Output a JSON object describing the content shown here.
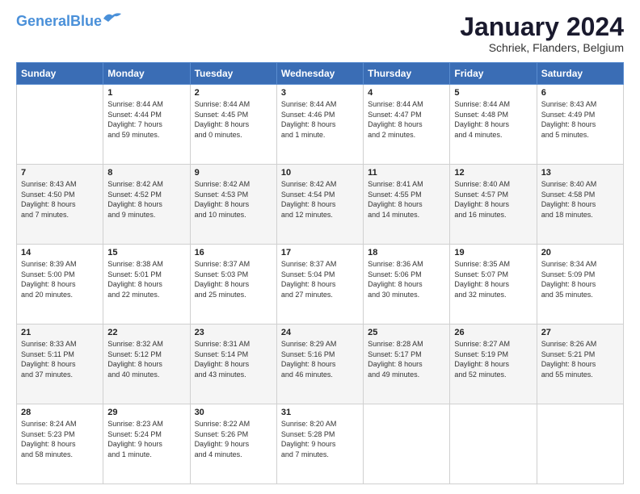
{
  "logo": {
    "part1": "General",
    "part2": "Blue"
  },
  "title": "January 2024",
  "subtitle": "Schriek, Flanders, Belgium",
  "headers": [
    "Sunday",
    "Monday",
    "Tuesday",
    "Wednesday",
    "Thursday",
    "Friday",
    "Saturday"
  ],
  "weeks": [
    [
      {
        "day": "",
        "info": ""
      },
      {
        "day": "1",
        "info": "Sunrise: 8:44 AM\nSunset: 4:44 PM\nDaylight: 7 hours\nand 59 minutes."
      },
      {
        "day": "2",
        "info": "Sunrise: 8:44 AM\nSunset: 4:45 PM\nDaylight: 8 hours\nand 0 minutes."
      },
      {
        "day": "3",
        "info": "Sunrise: 8:44 AM\nSunset: 4:46 PM\nDaylight: 8 hours\nand 1 minute."
      },
      {
        "day": "4",
        "info": "Sunrise: 8:44 AM\nSunset: 4:47 PM\nDaylight: 8 hours\nand 2 minutes."
      },
      {
        "day": "5",
        "info": "Sunrise: 8:44 AM\nSunset: 4:48 PM\nDaylight: 8 hours\nand 4 minutes."
      },
      {
        "day": "6",
        "info": "Sunrise: 8:43 AM\nSunset: 4:49 PM\nDaylight: 8 hours\nand 5 minutes."
      }
    ],
    [
      {
        "day": "7",
        "info": "Sunrise: 8:43 AM\nSunset: 4:50 PM\nDaylight: 8 hours\nand 7 minutes."
      },
      {
        "day": "8",
        "info": "Sunrise: 8:42 AM\nSunset: 4:52 PM\nDaylight: 8 hours\nand 9 minutes."
      },
      {
        "day": "9",
        "info": "Sunrise: 8:42 AM\nSunset: 4:53 PM\nDaylight: 8 hours\nand 10 minutes."
      },
      {
        "day": "10",
        "info": "Sunrise: 8:42 AM\nSunset: 4:54 PM\nDaylight: 8 hours\nand 12 minutes."
      },
      {
        "day": "11",
        "info": "Sunrise: 8:41 AM\nSunset: 4:55 PM\nDaylight: 8 hours\nand 14 minutes."
      },
      {
        "day": "12",
        "info": "Sunrise: 8:40 AM\nSunset: 4:57 PM\nDaylight: 8 hours\nand 16 minutes."
      },
      {
        "day": "13",
        "info": "Sunrise: 8:40 AM\nSunset: 4:58 PM\nDaylight: 8 hours\nand 18 minutes."
      }
    ],
    [
      {
        "day": "14",
        "info": "Sunrise: 8:39 AM\nSunset: 5:00 PM\nDaylight: 8 hours\nand 20 minutes."
      },
      {
        "day": "15",
        "info": "Sunrise: 8:38 AM\nSunset: 5:01 PM\nDaylight: 8 hours\nand 22 minutes."
      },
      {
        "day": "16",
        "info": "Sunrise: 8:37 AM\nSunset: 5:03 PM\nDaylight: 8 hours\nand 25 minutes."
      },
      {
        "day": "17",
        "info": "Sunrise: 8:37 AM\nSunset: 5:04 PM\nDaylight: 8 hours\nand 27 minutes."
      },
      {
        "day": "18",
        "info": "Sunrise: 8:36 AM\nSunset: 5:06 PM\nDaylight: 8 hours\nand 30 minutes."
      },
      {
        "day": "19",
        "info": "Sunrise: 8:35 AM\nSunset: 5:07 PM\nDaylight: 8 hours\nand 32 minutes."
      },
      {
        "day": "20",
        "info": "Sunrise: 8:34 AM\nSunset: 5:09 PM\nDaylight: 8 hours\nand 35 minutes."
      }
    ],
    [
      {
        "day": "21",
        "info": "Sunrise: 8:33 AM\nSunset: 5:11 PM\nDaylight: 8 hours\nand 37 minutes."
      },
      {
        "day": "22",
        "info": "Sunrise: 8:32 AM\nSunset: 5:12 PM\nDaylight: 8 hours\nand 40 minutes."
      },
      {
        "day": "23",
        "info": "Sunrise: 8:31 AM\nSunset: 5:14 PM\nDaylight: 8 hours\nand 43 minutes."
      },
      {
        "day": "24",
        "info": "Sunrise: 8:29 AM\nSunset: 5:16 PM\nDaylight: 8 hours\nand 46 minutes."
      },
      {
        "day": "25",
        "info": "Sunrise: 8:28 AM\nSunset: 5:17 PM\nDaylight: 8 hours\nand 49 minutes."
      },
      {
        "day": "26",
        "info": "Sunrise: 8:27 AM\nSunset: 5:19 PM\nDaylight: 8 hours\nand 52 minutes."
      },
      {
        "day": "27",
        "info": "Sunrise: 8:26 AM\nSunset: 5:21 PM\nDaylight: 8 hours\nand 55 minutes."
      }
    ],
    [
      {
        "day": "28",
        "info": "Sunrise: 8:24 AM\nSunset: 5:23 PM\nDaylight: 8 hours\nand 58 minutes."
      },
      {
        "day": "29",
        "info": "Sunrise: 8:23 AM\nSunset: 5:24 PM\nDaylight: 9 hours\nand 1 minute."
      },
      {
        "day": "30",
        "info": "Sunrise: 8:22 AM\nSunset: 5:26 PM\nDaylight: 9 hours\nand 4 minutes."
      },
      {
        "day": "31",
        "info": "Sunrise: 8:20 AM\nSunset: 5:28 PM\nDaylight: 9 hours\nand 7 minutes."
      },
      {
        "day": "",
        "info": ""
      },
      {
        "day": "",
        "info": ""
      },
      {
        "day": "",
        "info": ""
      }
    ]
  ]
}
